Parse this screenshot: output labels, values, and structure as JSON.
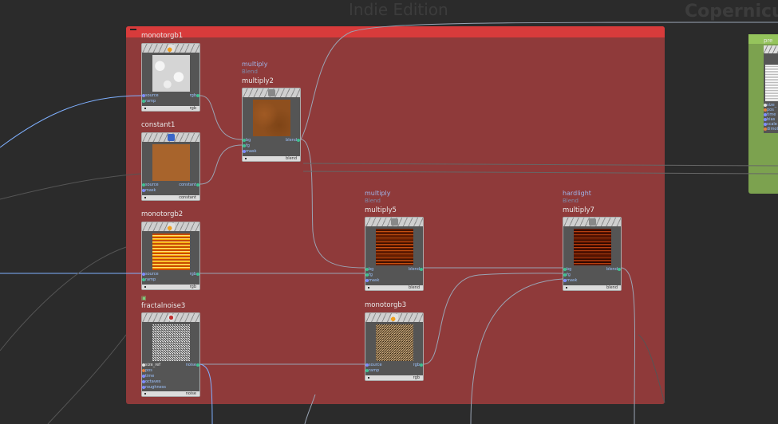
{
  "watermarks": {
    "edition": "Indie Edition",
    "context": "Copernicu"
  },
  "colors": {
    "background": "#2b2b2b",
    "network_box": "#8f3a3a",
    "network_box_bar": "#d83b3b",
    "green_box": "#7ca24f",
    "wire": "#9aa4b4",
    "wire_selected": "#7fb0ff"
  },
  "nodes": {
    "monotorgb1": {
      "name": "monotorgb1",
      "inputs": [
        "source",
        "ramp"
      ],
      "output": "rgb",
      "footer": "rgb",
      "icon": "palette-icon"
    },
    "constant1": {
      "name": "constant1",
      "inputs": [
        "source",
        "mask"
      ],
      "output": "constant",
      "footer": "constant",
      "icon": "square-icon"
    },
    "monotorgb2": {
      "name": "monotorgb2",
      "inputs": [
        "source",
        "ramp"
      ],
      "output": "rgb",
      "footer": "rgb",
      "icon": "palette-icon"
    },
    "fractalnoise3": {
      "name": "fractalnoise3",
      "inputs": [
        "size_ref",
        "pos",
        "time",
        "octaves",
        "roughness"
      ],
      "output": "noise",
      "footer": "noise",
      "icon": "noise-icon"
    },
    "multiply2": {
      "type": "multiply",
      "sub": "Blend",
      "name": "multiply2",
      "inputs": [
        "bg",
        "fg",
        "mask"
      ],
      "output": "blend",
      "footer": "blend",
      "icon": "blend-icon"
    },
    "multiply5": {
      "type": "multiply",
      "sub": "Blend",
      "name": "multiply5",
      "inputs": [
        "bg",
        "fg",
        "mask"
      ],
      "output": "blend",
      "footer": "blend",
      "icon": "blend-icon"
    },
    "monotorgb3": {
      "name": "monotorgb3",
      "inputs": [
        "source",
        "ramp"
      ],
      "output": "rgb",
      "footer": "rgb",
      "icon": "palette-icon"
    },
    "multiply7": {
      "type": "hardlight",
      "sub": "Blend",
      "name": "multiply7",
      "inputs": [
        "bg",
        "fg",
        "mask"
      ],
      "output": "blend",
      "footer": "blend",
      "icon": "blend-icon"
    }
  },
  "side_node": {
    "name": "pre",
    "inputs": [
      "size_",
      "pos",
      "time",
      "bias",
      "scale",
      "dimot"
    ]
  }
}
